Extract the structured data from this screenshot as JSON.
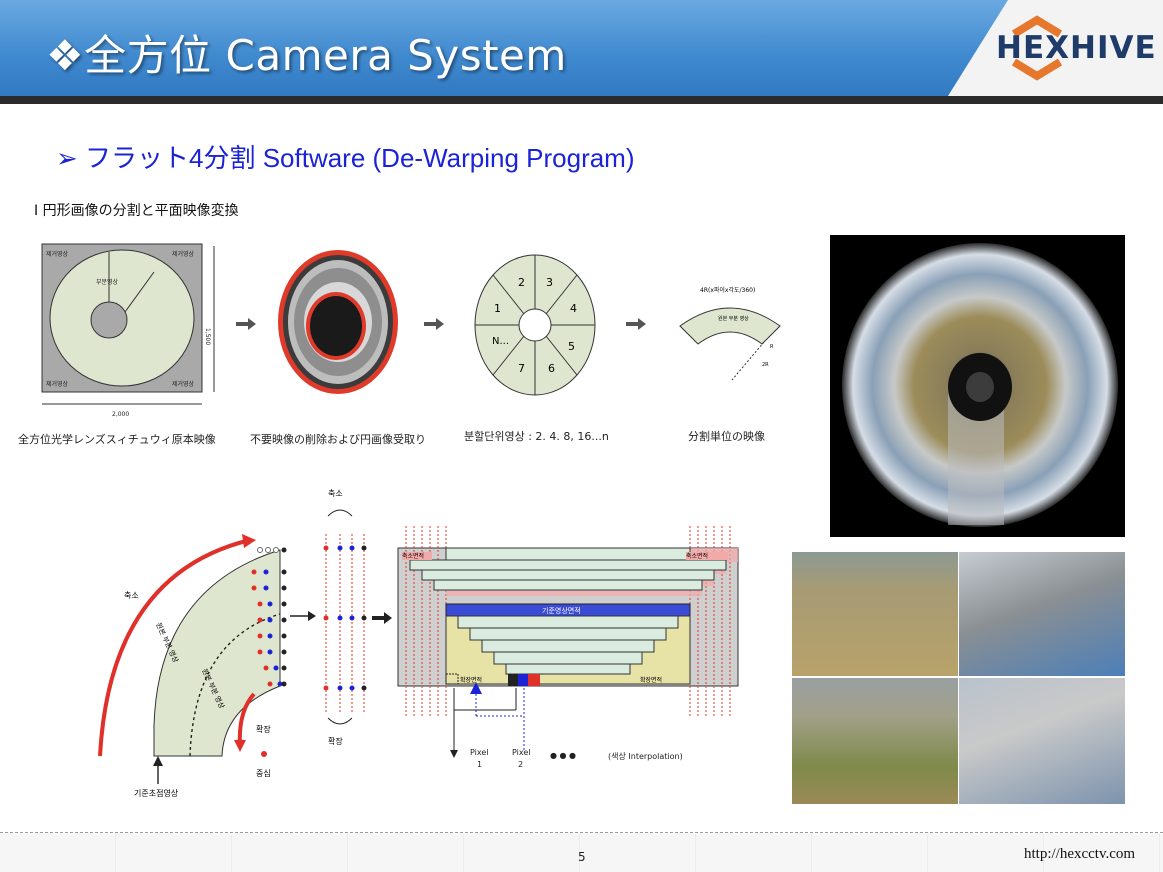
{
  "header": {
    "title": "❖全方位 Camera System",
    "logo_text": "HEXHIVE"
  },
  "subtitle": "➢  フラット4分割 Software (De-Warping Program)",
  "section_label": "I 円形画像の分割と平面映像変換",
  "diagram1": {
    "corner_labels": [
      "제거영상",
      "제거영상",
      "제거영상",
      "제거영상"
    ],
    "part_label": "부분영상",
    "dim_height": "1,500",
    "dim_width": "2,000",
    "caption": "全方位光学レンズスィチュウィ原本映像"
  },
  "diagram2": {
    "caption": "不要映像の削除および円画像受取り"
  },
  "diagram3": {
    "segments": [
      "2",
      "3",
      "4",
      "5",
      "6",
      "7",
      "N...",
      "1"
    ],
    "caption": "분할단위영상 : 2. 4. 8, 16...n"
  },
  "diagram4": {
    "formula": "4R(x파이x각도/360)",
    "inner_label": "원본 부분 영상",
    "r_label": "R",
    "r2_label": "2R",
    "caption": "分割単位の映像"
  },
  "diagram5": {
    "shrink_label": "축소",
    "original_label": "원본 부분 영상",
    "original_label_2": "원본 부분 영상",
    "expand_label": "확장",
    "center_label": "중심",
    "base_label": "기준초점영상",
    "top_shrink": "축소",
    "bottom_expand": "확장",
    "grid_shrink_left": "축소면적",
    "grid_shrink_right": "축소면적",
    "grid_base": "기준영상면적",
    "grid_expand_left": "확장면적",
    "grid_expand_right": "확장면적",
    "pixel1": "Pixel",
    "pixel1_num": "1",
    "pixel2": "Pixel",
    "pixel2_num": "2",
    "dots": "●  ●  ●",
    "interp": "(색상 Interpolation)"
  },
  "footer": {
    "page_number": "5",
    "url": "http://hexcctv.com"
  },
  "colors": {
    "header_blue": "#3f89cf",
    "subtitle_blue": "#1a23d6",
    "logo_navy": "#1f3b6a",
    "logo_orange": "#e8772e",
    "diagram_fill": "#dfe6cf",
    "diagram_gray": "#a9a9a9",
    "red": "#e0302a"
  }
}
